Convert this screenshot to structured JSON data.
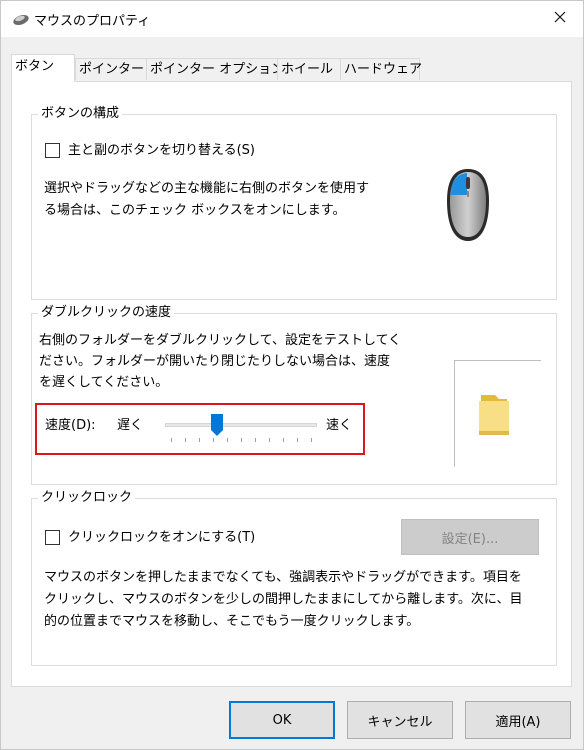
{
  "window": {
    "title": "マウスのプロパティ"
  },
  "tabs": [
    {
      "label": "ボタン",
      "active": true
    },
    {
      "label": "ポインター"
    },
    {
      "label": "ポインター オプション"
    },
    {
      "label": "ホイール"
    },
    {
      "label": "ハードウェア"
    }
  ],
  "button_config": {
    "title": "ボタンの構成",
    "swap_checkbox_label": "主と副のボタンを切り替える(S)",
    "swap_checked": false,
    "description_line1": "選択やドラッグなどの主な機能に右側のボタンを使用す",
    "description_line2": "る場合は、このチェック ボックスをオンにします。",
    "mouse_icon": "mouse-icon"
  },
  "double_click": {
    "title": "ダブルクリックの速度",
    "description_line1": "右側のフォルダーをダブルクリックして、設定をテストしてく",
    "description_line2": "ださい。フォルダーが開いたり閉じたりしない場合は、速度",
    "description_line3": "を遅くしてください。",
    "speed_label": "速度(D):",
    "slow_label": "遅く",
    "fast_label": "速く",
    "speed_fraction": 0.33,
    "test_icon": "folder-icon"
  },
  "click_lock": {
    "title": "クリックロック",
    "checkbox_label": "クリックロックをオンにする(T)",
    "checked": false,
    "settings_button": "設定(E)...",
    "description_line1": "マウスのボタンを押したままでなくても、強調表示やドラッグができます。項目を",
    "description_line2": "クリックし、マウスのボタンを少しの間押したままにしてから離します。次に、目",
    "description_line3": "的の位置までマウスを移動し、そこでもう一度クリックします。"
  },
  "footer": {
    "ok": "OK",
    "cancel": "キャンセル",
    "apply": "適用(A)"
  },
  "colors": {
    "highlight": "#e0151b",
    "accent": "#0078d7",
    "folder": "#f5d76e"
  }
}
